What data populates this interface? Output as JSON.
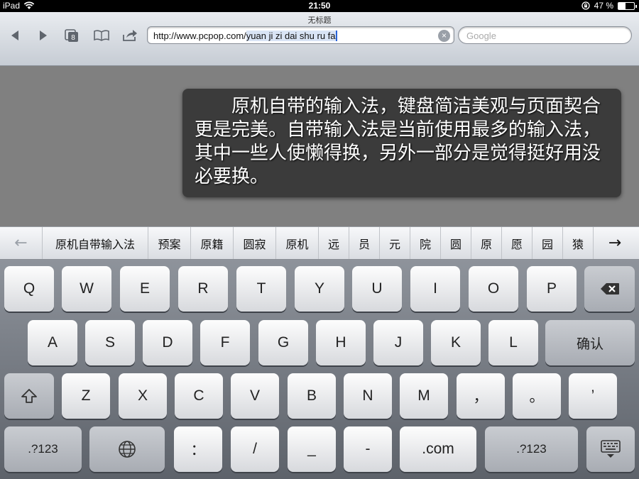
{
  "status_bar": {
    "device": "iPad",
    "time": "21:50",
    "battery": "47 %",
    "battery_level": 0.47
  },
  "browser": {
    "page_title": "无标题",
    "url_prefix": "http://www.pcpop.com/",
    "url_marked": "yuan ji zi dai shu ru fa",
    "search_placeholder": "Google",
    "tab_count": "8",
    "clear_glyph": "×"
  },
  "page": {
    "caption": "原机自带的输入法，键盘简洁美观与页面契合更是完美。自带输入法是当前使用最多的输入法，其中一些人使懒得换，另外一部分是觉得挺好用没必要换。"
  },
  "candidate_bar": {
    "left_arrow": "←",
    "right_arrow": "→",
    "candidates": [
      "原机自带输入法",
      "预案",
      "原籍",
      "圆寂",
      "原机",
      "远",
      "员",
      "元",
      "院",
      "圆",
      "原",
      "愿",
      "园",
      "猿"
    ]
  },
  "keyboard": {
    "row1": [
      "Q",
      "W",
      "E",
      "R",
      "T",
      "Y",
      "U",
      "I",
      "O",
      "P"
    ],
    "row2": [
      "A",
      "S",
      "D",
      "F",
      "G",
      "H",
      "J",
      "K",
      "L"
    ],
    "confirm": "确认",
    "row3": [
      "Z",
      "X",
      "C",
      "V",
      "B",
      "N",
      "M",
      "，",
      "。",
      "’"
    ],
    "numbers_left": ".?123",
    "colon": "：",
    "slash": "/",
    "underscore": "_",
    "dash": "-",
    "dotcom": ".com",
    "numbers_right": ".?123"
  }
}
